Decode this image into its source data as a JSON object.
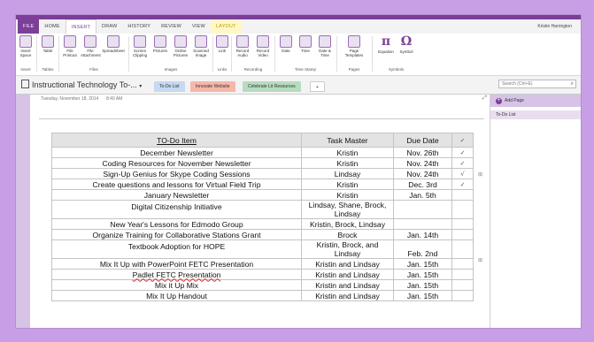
{
  "user": "Kristin Harrington",
  "ribbon_tabs": [
    "FILE",
    "HOME",
    "INSERT",
    "DRAW",
    "HISTORY",
    "REVIEW",
    "VIEW",
    "LAYOUT"
  ],
  "ribbon": {
    "buttons": [
      {
        "label": "Insert Space"
      },
      {
        "label": "Table"
      },
      {
        "label": "File Printout"
      },
      {
        "label": "File Attachment"
      },
      {
        "label": "Spreadsheet"
      },
      {
        "label": "Screen Clipping"
      },
      {
        "label": "Pictures"
      },
      {
        "label": "Online Pictures"
      },
      {
        "label": "Scanned Image"
      },
      {
        "label": "Link"
      },
      {
        "label": "Record Audio"
      },
      {
        "label": "Record Video"
      },
      {
        "label": "Date"
      },
      {
        "label": "Time"
      },
      {
        "label": "Date & Time"
      },
      {
        "label": "Page Templates"
      },
      {
        "label": "Equation"
      },
      {
        "label": "Symbol"
      }
    ],
    "groups": [
      "Insert",
      "Tables",
      "Files",
      "Images",
      "Links",
      "Recording",
      "Time Stamp",
      "Pages",
      "Symbols"
    ]
  },
  "notebook": {
    "title": "Instructional Technology To-...",
    "section_tabs": [
      {
        "label": "To-Do List",
        "color": "#c6d9f1"
      },
      {
        "label": "Innovate Website",
        "color": "#f6b7a9"
      },
      {
        "label": "Celebrate Lit Resources",
        "color": "#b6dcc0"
      }
    ],
    "add_tab": "+",
    "search_placeholder": "Search (Ctrl+E)"
  },
  "page": {
    "date": "Tuesday, November 18, 2014",
    "time": "8:40 AM",
    "dots": "......"
  },
  "table": {
    "headers": [
      "TO-Do Item",
      "Task Master",
      "Due Date",
      "✓"
    ],
    "rows": [
      {
        "item": "December Newsletter",
        "master": "Kristin",
        "due": "Nov. 26th",
        "check": "✓"
      },
      {
        "item": "Coding Resources for November Newsletter",
        "master": "Kristin",
        "due": "Nov. 24th",
        "check": "✓"
      },
      {
        "item": "Sign-Up Genius for Skype Coding Sessions",
        "master": "Lindsay",
        "due": "Nov. 24th",
        "check": "√"
      },
      {
        "item": "Create questions and lessons for Virtual Field Trip",
        "master": "Kristin",
        "due": "Dec. 3rd",
        "check": "✓"
      },
      {
        "item": "January Newsletter",
        "master": "Kristin",
        "due": "Jan. 5th",
        "check": ""
      },
      {
        "item": "Digital Citizenship Initiative",
        "master": "Lindsay, Shane, Brock, Lindsay",
        "due": "",
        "check": ""
      },
      {
        "item": "New Year's Lessons for Edmodo Group",
        "master": "Kristin, Brock, Lindsay",
        "due": "",
        "check": ""
      },
      {
        "item": "Organize Training for Collaborative Stations Grant",
        "master": "Brock",
        "due": "Jan. 14th",
        "check": ""
      },
      {
        "item": "Textbook Adoption for HOPE",
        "master": "Kristin, Brock, and Lindsay",
        "due": "Feb. 2nd",
        "check": ""
      },
      {
        "item": "Mix It Up with PowerPoint FETC Presentation",
        "master": "Kristin and Lindsay",
        "due": "Jan. 15th",
        "check": ""
      },
      {
        "item": "Padlet FETC Presentation",
        "master": "Kristin and Lindsay",
        "due": "Jan. 15th",
        "check": ""
      },
      {
        "item": "Mix it Up Mix",
        "master": "Kristin and Lindsay",
        "due": "Jan. 15th",
        "check": ""
      },
      {
        "item": "Mix It Up Handout",
        "master": "Kristin and Lindsay",
        "due": "Jan. 15th",
        "check": ""
      }
    ]
  },
  "right_pane": {
    "add_page": "Add Page",
    "pages": [
      "To-Do List"
    ]
  },
  "colors": {
    "accent": "#7c3f98",
    "background": "#c89ee6",
    "header_row": "#e3e3e3"
  }
}
